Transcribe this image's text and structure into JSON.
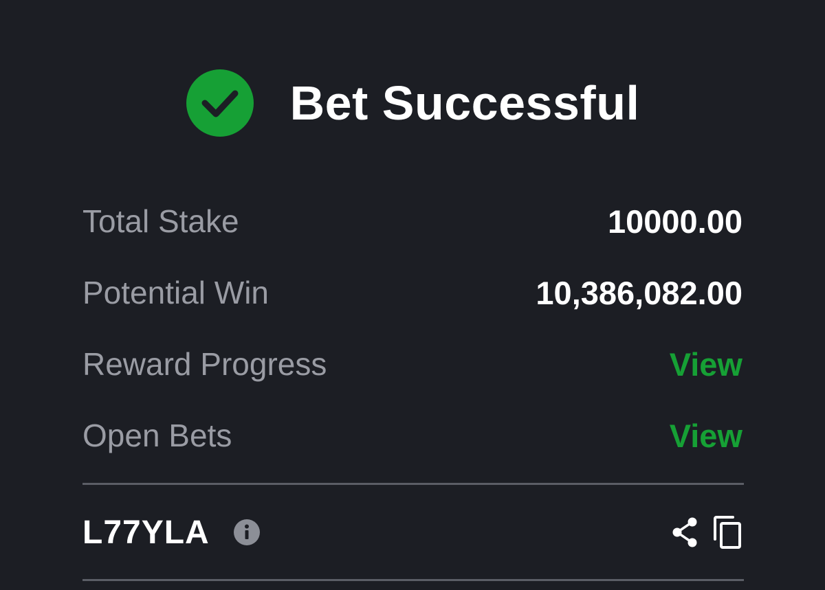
{
  "header": {
    "icon": "check-circle-icon",
    "title": "Bet Successful",
    "accent_color": "#16a035"
  },
  "summary": {
    "rows": [
      {
        "label": "Total Stake",
        "value": "10000.00"
      },
      {
        "label": "Potential Win",
        "value": "10,386,082.00"
      },
      {
        "label": "Reward Progress",
        "value": "View"
      },
      {
        "label": "Open Bets",
        "value": "View"
      }
    ]
  },
  "booking": {
    "code": "L77YLA",
    "info_icon": "info-icon",
    "share_icon": "share-icon",
    "copy_icon": "copy-icon"
  }
}
